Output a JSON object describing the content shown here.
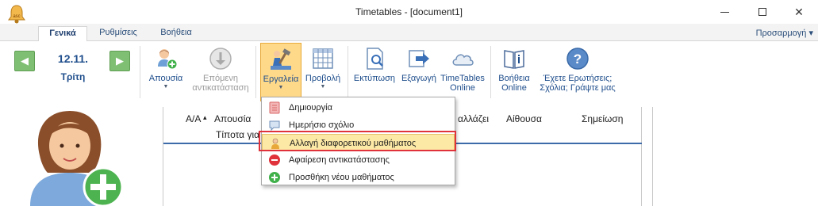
{
  "window": {
    "title": "Timetables - [document1]",
    "app_icon": "bell-icon",
    "minimize_icon": "minimize-icon",
    "maximize_icon": "maximize-icon",
    "close_glyph": "✕"
  },
  "tabs": [
    {
      "label": "Γενικά",
      "active": true
    },
    {
      "label": "Ρυθμίσεις",
      "active": false
    },
    {
      "label": "Βοήθεια",
      "active": false
    }
  ],
  "customize_label": "Προσαρμογή ▾",
  "date_nav": {
    "prev_glyph": "◀",
    "next_glyph": "▶",
    "date": "12.11.",
    "day": "Τρίτη"
  },
  "ribbon": {
    "absence": {
      "label": "Απουσία",
      "icon": "user-add-icon"
    },
    "next_substitution": {
      "line1": "Επόμενη",
      "line2": "αντικατάσταση",
      "icon": "down-arrow-icon"
    },
    "tools": {
      "label": "Εργαλεία",
      "icon": "tools-icon"
    },
    "view": {
      "label": "Προβολή",
      "icon": "grid-view-icon"
    },
    "print": {
      "label": "Εκτύπωση",
      "icon": "print-preview-icon"
    },
    "export": {
      "label": "Εξαγωγή",
      "icon": "export-icon"
    },
    "online": {
      "line1": "TimeTables",
      "line2": "Online",
      "icon": "cloud-icon"
    },
    "help_online": {
      "line1": "Βοήθεια",
      "line2": "Online",
      "icon": "help-book-icon"
    },
    "questions": {
      "line1": "Έχετε Ερωτήσεις;",
      "line2": "Σχόλια; Γράψτε μας",
      "icon": "question-icon"
    }
  },
  "grid": {
    "columns": {
      "number": "Α/Α",
      "sort_glyph": "▴",
      "absence": "Απουσία",
      "changes": "αλλάζει",
      "room": "Αίθουσα",
      "note": "Σημείωση"
    },
    "empty_message": "Τίποτα για"
  },
  "dropdown_menu": [
    {
      "label": "Δημιουργία",
      "icon": "create-icon",
      "highlighted": false
    },
    {
      "label": "Ημερήσιο σχόλιο",
      "icon": "comment-icon",
      "highlighted": false
    },
    {
      "label": "Αλλαγή διαφορετικού μαθήματος",
      "icon": "change-lesson-icon",
      "highlighted": true
    },
    {
      "label": "Αφαίρεση αντικατάστασης",
      "icon": "remove-icon",
      "highlighted": false
    },
    {
      "label": "Προσθήκη νέου μαθήματος",
      "icon": "add-icon",
      "highlighted": false
    }
  ],
  "colors": {
    "accent": "#1f4e8c",
    "nav_green": "#7fbf73",
    "highlight": "#fde9a6",
    "red_frame": "#e0323a",
    "header_rule": "#3d6aa8"
  }
}
